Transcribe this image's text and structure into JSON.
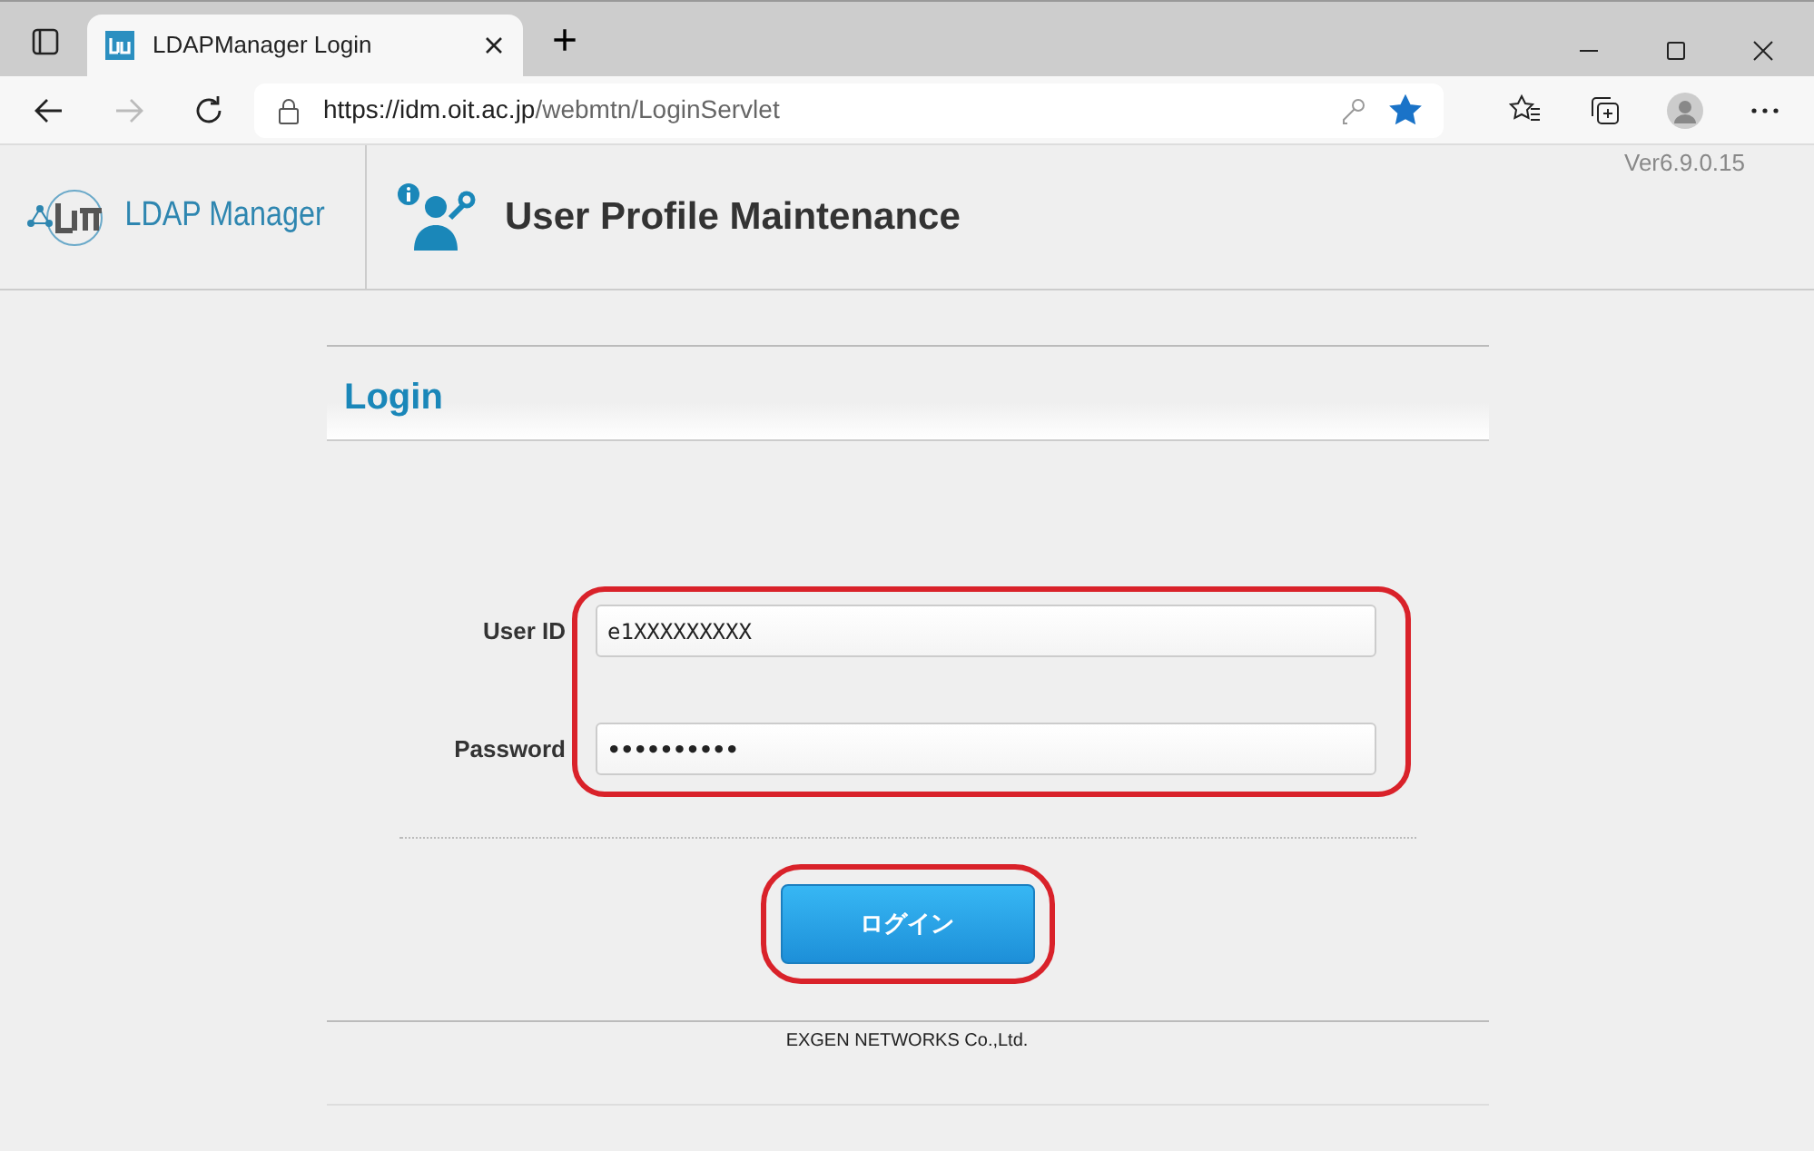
{
  "browser": {
    "tab": {
      "title": "LDAPManager Login",
      "selected": true
    },
    "new_tab": "+",
    "url": {
      "host": "https://idm.oit.ac.jp",
      "path": "/webmtn/LoginServlet"
    },
    "favorite": true
  },
  "header": {
    "logo_text": "LDAP Manager",
    "title": "User Profile Maintenance",
    "version": "Ver6.9.0.15"
  },
  "panel": {
    "title": "Login",
    "fields_highlighted": true,
    "fields": [
      {
        "label": "User ID",
        "value": "e1XXXXXXXXX"
      },
      {
        "label": "Password",
        "value": "••••••••••"
      }
    ],
    "login_button": {
      "label": "ログイン",
      "highlighted": true
    }
  },
  "footer": "EXGEN NETWORKS Co.,Ltd."
}
